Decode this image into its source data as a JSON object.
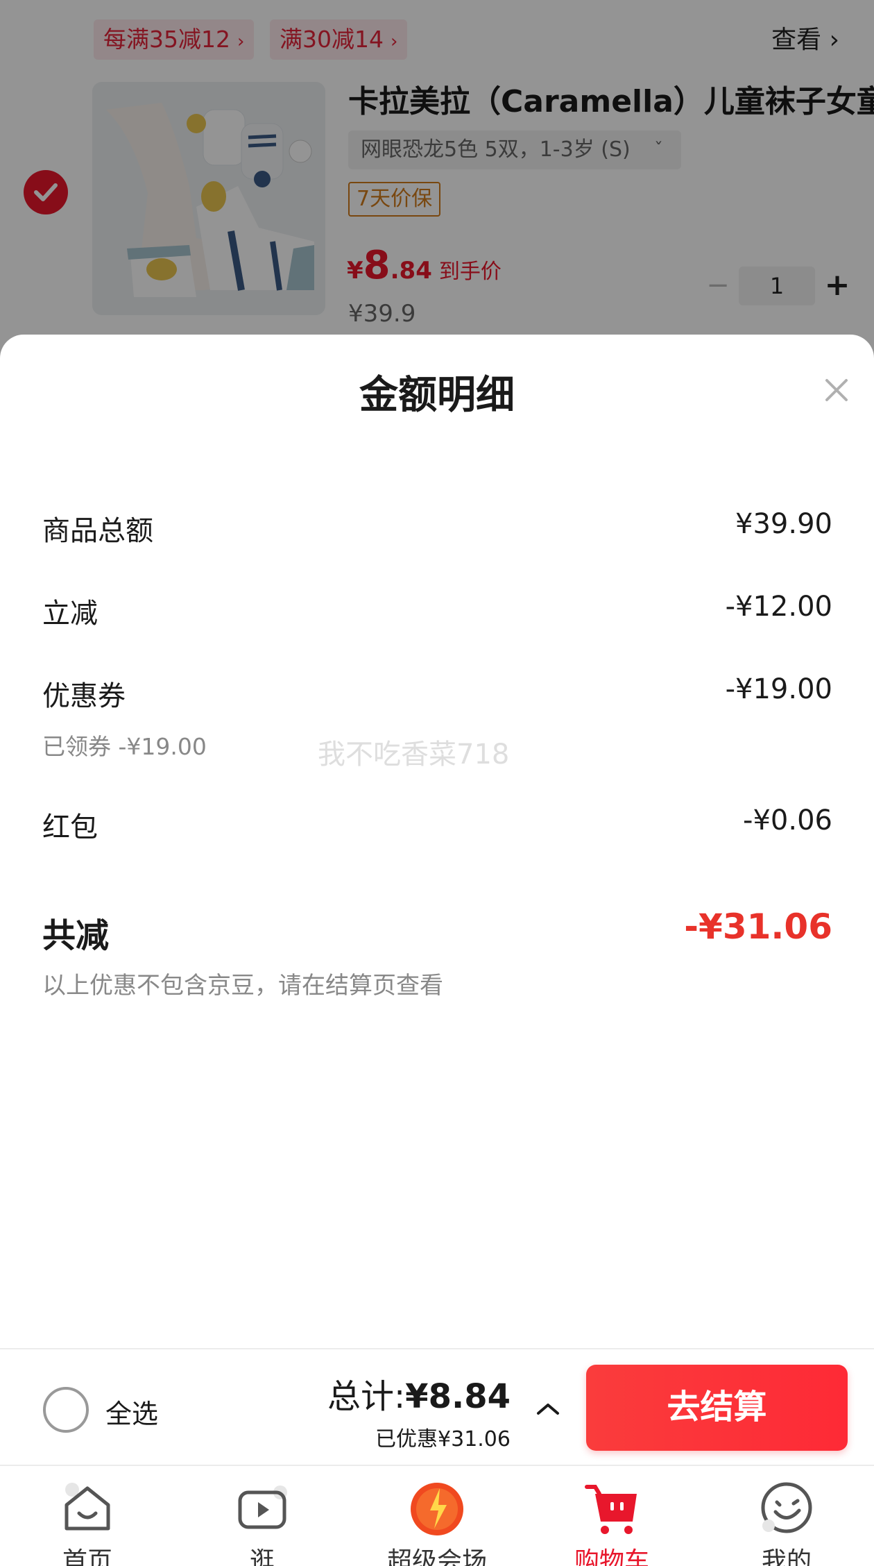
{
  "cart_item": {
    "promo_tags": [
      "每满35减12",
      "满30减14"
    ],
    "view_link": "查看",
    "title": "卡拉美拉（Caramella）儿童袜子女童",
    "variant": "网眼恐龙5色 5双，1-3岁 (S)",
    "guarantee_badge": "7天价保",
    "price_symbol": "¥",
    "price_int": "8",
    "price_dec": ".84",
    "price_tip": "到手价",
    "original_price": "¥39.9",
    "quantity": "1",
    "checked": true
  },
  "sheet": {
    "title": "金额明细",
    "rows": [
      {
        "label": "商品总额",
        "value": "¥39.90"
      },
      {
        "label": "立减",
        "value": "-¥12.00"
      },
      {
        "label": "优惠券",
        "value": "-¥19.00",
        "sub": "已领券 -¥19.00"
      },
      {
        "label": "红包",
        "value": "-¥0.06"
      }
    ],
    "total_label": "共减",
    "total_value": "-¥31.06",
    "note": "以上优惠不包含京豆，请在结算页查看",
    "watermark": "我不吃香菜718"
  },
  "settle": {
    "select_all": "全选",
    "total_prefix": "总计:",
    "total_amount": "¥8.84",
    "saved": "已优惠¥31.06",
    "checkout": "去结算"
  },
  "tabs": [
    {
      "label": "首页",
      "icon": "home-icon"
    },
    {
      "label": "逛",
      "icon": "video-play-icon"
    },
    {
      "label": "超级会场",
      "icon": "super-venue-icon"
    },
    {
      "label": "购物车",
      "icon": "shopping-cart-icon",
      "active": true
    },
    {
      "label": "我的",
      "icon": "smiley-profile-icon"
    }
  ],
  "colors": {
    "accent_red": "#e8172c",
    "total_red": "#e8322a",
    "checkout_gradient": [
      "#fa3c3c",
      "#fe2a36"
    ]
  }
}
